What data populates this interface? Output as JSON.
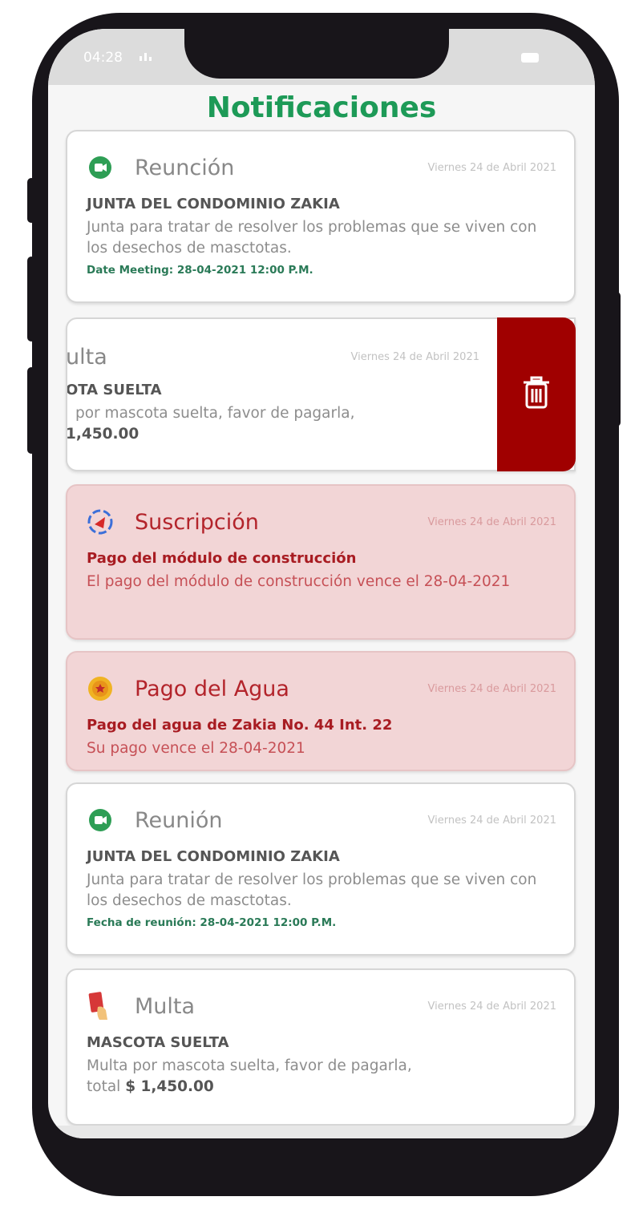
{
  "status_bar": {
    "time": "04:28"
  },
  "page_title": "Notificaciones",
  "swiped_card": {
    "type": "ulta",
    "date": "Viernes 24 de Abril 2021",
    "subject": "OTA SUELTA",
    "body": "por mascota suelta, favor de pagarla,",
    "total": "1,450.00"
  },
  "cards": [
    {
      "icon": "meet-icon",
      "type": "Reunción",
      "date": "Viernes 24 de Abril 2021",
      "subject": "JUNTA DEL CONDOMINIO ZAKIA",
      "body": "Junta para tratar de resolver los problemas que se viven con los desechos de masctotas.",
      "meeting": "Date Meeting: 28-04-2021 12:00 P.M.",
      "style": "white"
    },
    {
      "icon": "subscription-icon",
      "type": "Suscripción",
      "date": "Viernes 24 de Abril 2021",
      "subject": "Pago del módulo de construcción",
      "body": "El pago del módulo de construcción vence el 28-04-2021",
      "style": "pink"
    },
    {
      "icon": "coin-icon",
      "type": "Pago del Agua",
      "date": "Viernes 24 de Abril 2021",
      "subject": "Pago del agua de Zakia No. 44 Int. 22",
      "body": "Su pago vence el 28-04-2021",
      "style": "pink"
    },
    {
      "icon": "meet-icon",
      "type": "Reunión",
      "date": "Viernes 24 de Abril 2021",
      "subject": "JUNTA DEL CONDOMINIO ZAKIA",
      "body": "Junta para tratar de resolver los problemas que se viven con los desechos de masctotas.",
      "meeting": "Fecha de reunión: 28-04-2021 12:00 P.M.",
      "style": "white"
    },
    {
      "icon": "red-card-icon",
      "type": "Multa",
      "date": "Viernes 24 de Abril 2021",
      "subject": "MASCOTA SUELTA",
      "body": "Multa por mascota suelta, favor de pagarla,",
      "total_label": "total",
      "total": "$ 1,450.00",
      "style": "white"
    }
  ]
}
